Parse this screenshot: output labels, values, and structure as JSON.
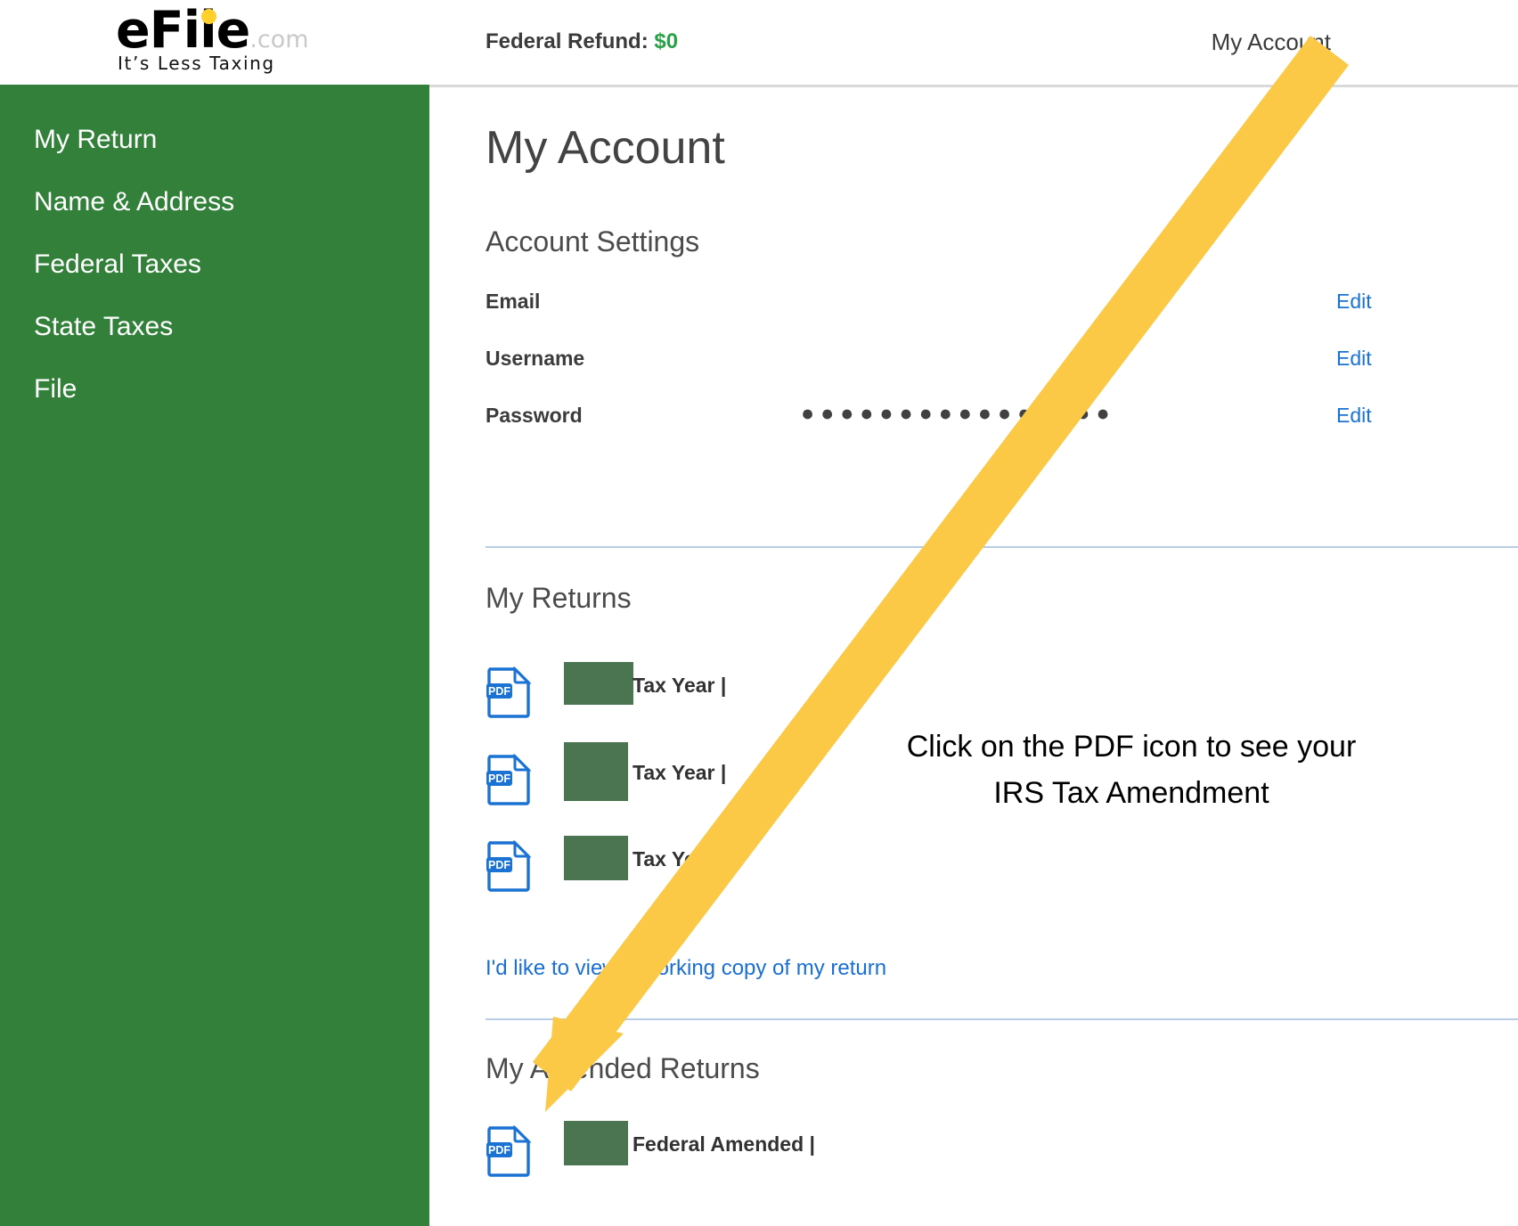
{
  "header": {
    "logo_main": "eFile",
    "logo_suffix": ".com",
    "logo_tagline": "It’s Less Taxing",
    "refund_label": "Federal Refund:",
    "refund_amount": "$0",
    "refund_color": "#2aa148",
    "my_account_link": "My Account"
  },
  "sidebar": {
    "background_color": "#33803a",
    "items": [
      {
        "label": "My Return"
      },
      {
        "label": "Name & Address"
      },
      {
        "label": "Federal Taxes"
      },
      {
        "label": "State Taxes"
      },
      {
        "label": "File"
      }
    ]
  },
  "main": {
    "page_title": "My Account",
    "account_settings": {
      "heading": "Account Settings",
      "rows": [
        {
          "label": "Email",
          "value": "",
          "edit_label": "Edit"
        },
        {
          "label": "Username",
          "value": "",
          "edit_label": "Edit"
        },
        {
          "label": "Password",
          "value": "●●●●●●●●●●●●●●●●",
          "edit_label": "Edit"
        }
      ]
    },
    "my_returns": {
      "heading": "My Returns",
      "rows": [
        {
          "icon": "pdf-icon",
          "label": "Tax Year  |"
        },
        {
          "icon": "pdf-icon",
          "label": "Tax Year  |"
        },
        {
          "icon": "pdf-icon",
          "label": "Tax Year  |"
        }
      ],
      "working_copy_link": "I'd like to view a working copy of my return"
    },
    "my_amended_returns": {
      "heading": "My Amended Returns",
      "rows": [
        {
          "icon": "pdf-icon",
          "label": "Federal Amended  |"
        }
      ]
    }
  },
  "annotation": {
    "line1": "Click on the PDF icon to see your",
    "line2": "IRS Tax Amendment",
    "arrow_color": "#fbc946",
    "text_color": "#000000"
  },
  "colors": {
    "sidebar_green": "#33803a",
    "redaction_green": "#4b7450",
    "link_blue": "#1a6fd4",
    "divider_blue": "#b9cce6",
    "pdf_blue": "#1a73d4"
  }
}
